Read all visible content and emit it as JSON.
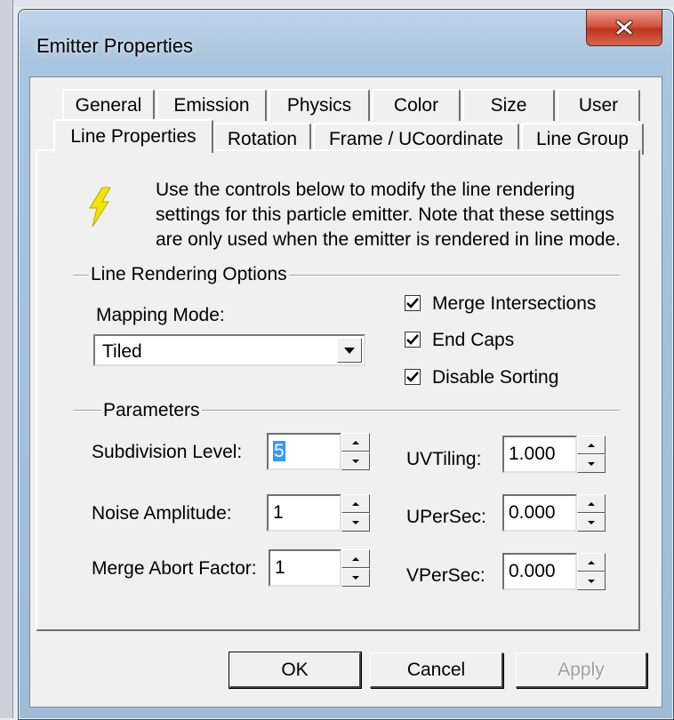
{
  "window": {
    "title": "Emitter Properties"
  },
  "tabs_row1": [
    "General",
    "Emission",
    "Physics",
    "Color",
    "Size",
    "User"
  ],
  "tabs_row2": [
    "Line Properties",
    "Rotation",
    "Frame / UCoordinate",
    "Line Group"
  ],
  "active_tab": "Line Properties",
  "description": {
    "line1": "Use the controls below to modify the line rendering",
    "line2": "settings for this particle emitter.  Note that these settings",
    "line3": "are only used when the emitter is rendered in line mode."
  },
  "line_rendering": {
    "group_label": "Line Rendering Options",
    "mapping_mode_label": "Mapping Mode:",
    "mapping_mode_value": "Tiled",
    "merge_intersections": {
      "label": "Merge Intersections",
      "checked": true
    },
    "end_caps": {
      "label": "End Caps",
      "checked": true
    },
    "disable_sorting": {
      "label": "Disable Sorting",
      "checked": true
    }
  },
  "parameters": {
    "group_label": "Parameters",
    "subdivision_level": {
      "label": "Subdivision Level:",
      "value": "5"
    },
    "noise_amplitude": {
      "label": "Noise Amplitude:",
      "value": "1"
    },
    "merge_abort_factor": {
      "label": "Merge Abort Factor:",
      "value": "1"
    },
    "uv_tiling": {
      "label": "UVTiling:",
      "value": "1.000"
    },
    "u_per_sec": {
      "label": "UPerSec:",
      "value": "0.000"
    },
    "v_per_sec": {
      "label": "VPerSec:",
      "value": "0.000"
    }
  },
  "buttons": {
    "ok": "OK",
    "cancel": "Cancel",
    "apply": "Apply"
  },
  "icons": {
    "lightning": "lightning-icon",
    "close": "close-icon"
  },
  "colors": {
    "lightning": "#f2e600",
    "close_button": "#c9412b",
    "selection": "#3399ff"
  }
}
